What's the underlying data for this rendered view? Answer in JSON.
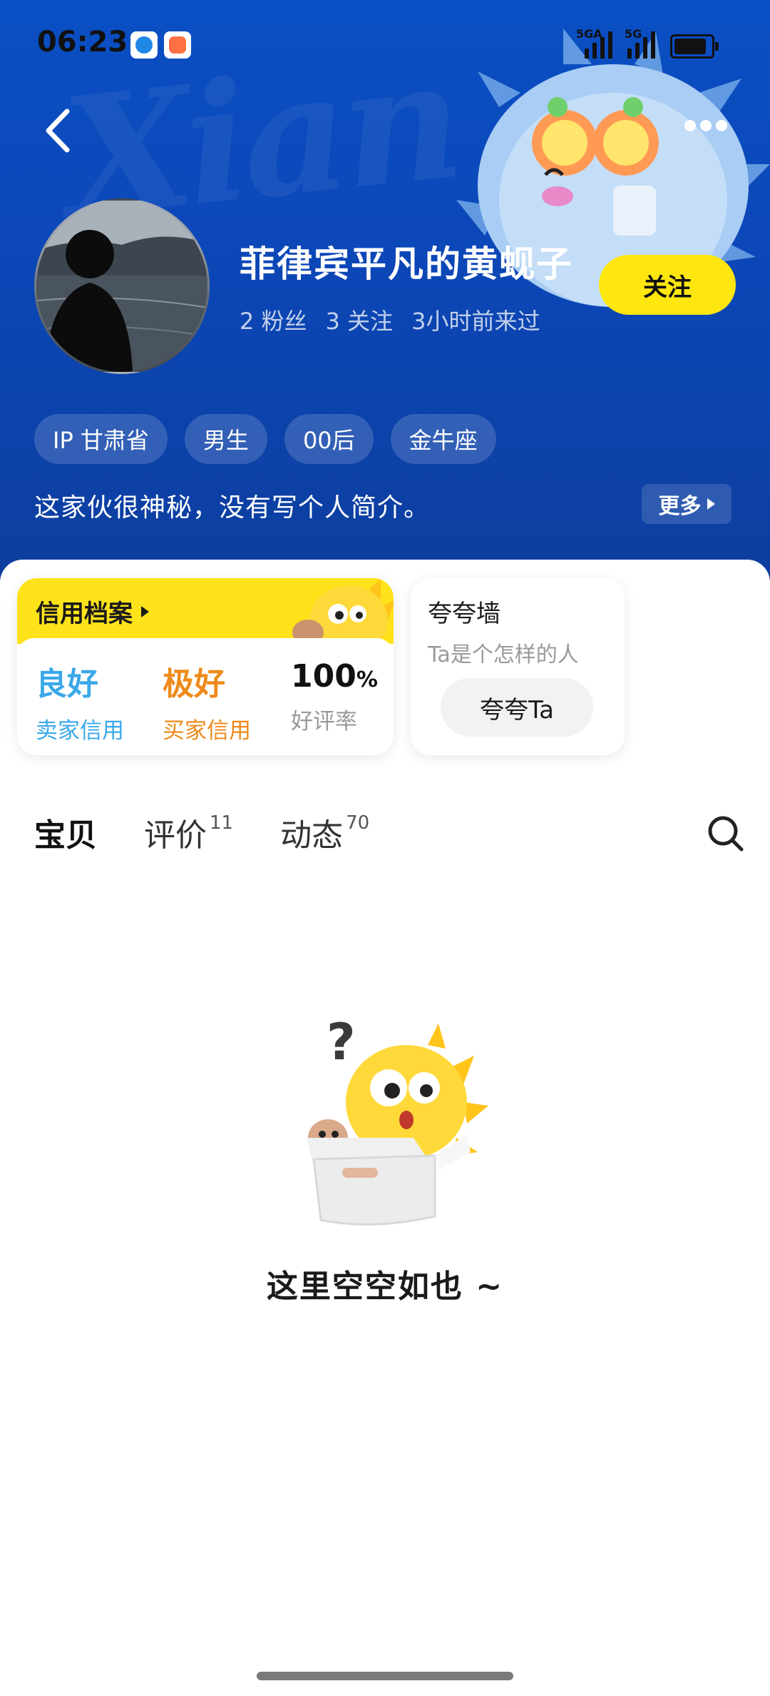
{
  "status_bar": {
    "time": "06:23",
    "net1": "5GA",
    "net2": "5G"
  },
  "header": {
    "background_text": "Xian",
    "nickname": "菲律宾平凡的黄蚬子",
    "stats": [
      "2 粉丝",
      "3 关注",
      "3小时前来过"
    ],
    "follow_label": "关注",
    "tags": [
      "IP 甘肃省",
      "男生",
      "00后",
      "金牛座"
    ],
    "bio": "这家伙很神秘，没有写个人简介。",
    "more_label": "更多"
  },
  "credit": {
    "title": "信用档案",
    "metrics": [
      {
        "value": "良好",
        "label": "卖家信用",
        "color": "#3aa8ea"
      },
      {
        "value": "极好",
        "label": "买家信用",
        "color": "#ee8a1a"
      },
      {
        "value": "100",
        "value_suffix": "%",
        "label": "好评率",
        "color": "#111111"
      }
    ]
  },
  "praise": {
    "title": "夸夸墙",
    "subtitle": "Ta是个怎样的人",
    "button": "夸夸Ta"
  },
  "tabs": [
    {
      "label": "宝贝",
      "count": ""
    },
    {
      "label": "评价",
      "count": "11"
    },
    {
      "label": "动态",
      "count": "70"
    }
  ],
  "empty_state": {
    "text": "这里空空如也 ~"
  },
  "colors": {
    "brand_yellow": "#ffe31a",
    "header_blue": "#0c47b7"
  }
}
